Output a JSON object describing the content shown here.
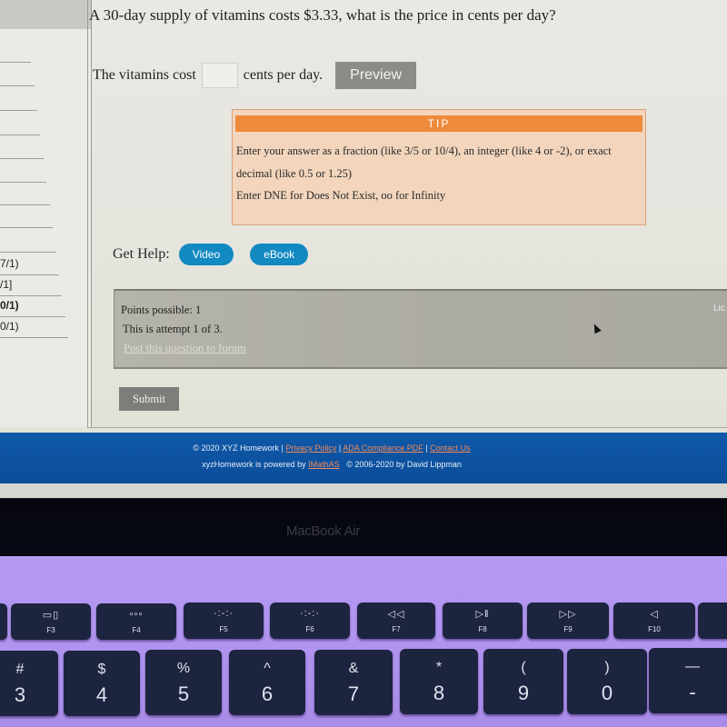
{
  "question": {
    "text": "A 30-day supply of vitamins costs $3.33, what is the price in cents per day?",
    "answer_prefix": "The vitamins cost",
    "answer_value": "",
    "answer_suffix": "cents per day.",
    "preview_label": "Preview"
  },
  "tip": {
    "title": "TIP",
    "line1": "Enter your answer as a fraction (like 3/5 or 10/4), an integer (like 4 or -2), or exact",
    "line2": "decimal (like 0.5 or 1.25)",
    "line3": "Enter DNE for Does Not Exist, oo for Infinity"
  },
  "help": {
    "label": "Get Help:",
    "video_label": "Video",
    "ebook_label": "eBook"
  },
  "points": {
    "possible": "Points possible: 1",
    "attempt": "This is attempt 1 of 3.",
    "forum_link": "Post this question to forum",
    "side_link": "Lic"
  },
  "submit_label": "Submit",
  "sidebar": {
    "scores": [
      "7/1)",
      "/1]",
      "0/1)",
      "0/1)"
    ]
  },
  "footer": {
    "copyright": "© 2020 XYZ Homework",
    "privacy": "Privacy Policy",
    "ada": "ADA Compliance PDF",
    "contact": "Contact Us",
    "powered_prefix": "xyzHomework is powered by",
    "imathas": "IMathAS",
    "credits": "© 2006-2020 by David Lippman"
  },
  "bezel_label": "MacBook Air",
  "keyboard": {
    "fkeys": [
      {
        "icon": "▭▯",
        "label": "F3",
        "name": "mission-control"
      },
      {
        "icon": "▫▫▫",
        "label": "F4",
        "name": "launchpad"
      },
      {
        "icon": "·:‐:·",
        "label": "F5",
        "name": "keyboard-brightness-down"
      },
      {
        "icon": "·:‑:·",
        "label": "F6",
        "name": "keyboard-brightness-up"
      },
      {
        "icon": "◁◁",
        "label": "F7",
        "name": "rewind"
      },
      {
        "icon": "▷‖",
        "label": "F8",
        "name": "play-pause"
      },
      {
        "icon": "▷▷",
        "label": "F9",
        "name": "fast-forward"
      },
      {
        "icon": "◁",
        "label": "F10",
        "name": "mute"
      }
    ],
    "numkeys": [
      {
        "sym": "#",
        "num": "3"
      },
      {
        "sym": "$",
        "num": "4"
      },
      {
        "sym": "%",
        "num": "5"
      },
      {
        "sym": "^",
        "num": "6"
      },
      {
        "sym": "&",
        "num": "7"
      },
      {
        "sym": "*",
        "num": "8"
      },
      {
        "sym": "(",
        "num": "9"
      },
      {
        "sym": ")",
        "num": "0"
      },
      {
        "sym": "—",
        "num": "-"
      }
    ]
  }
}
